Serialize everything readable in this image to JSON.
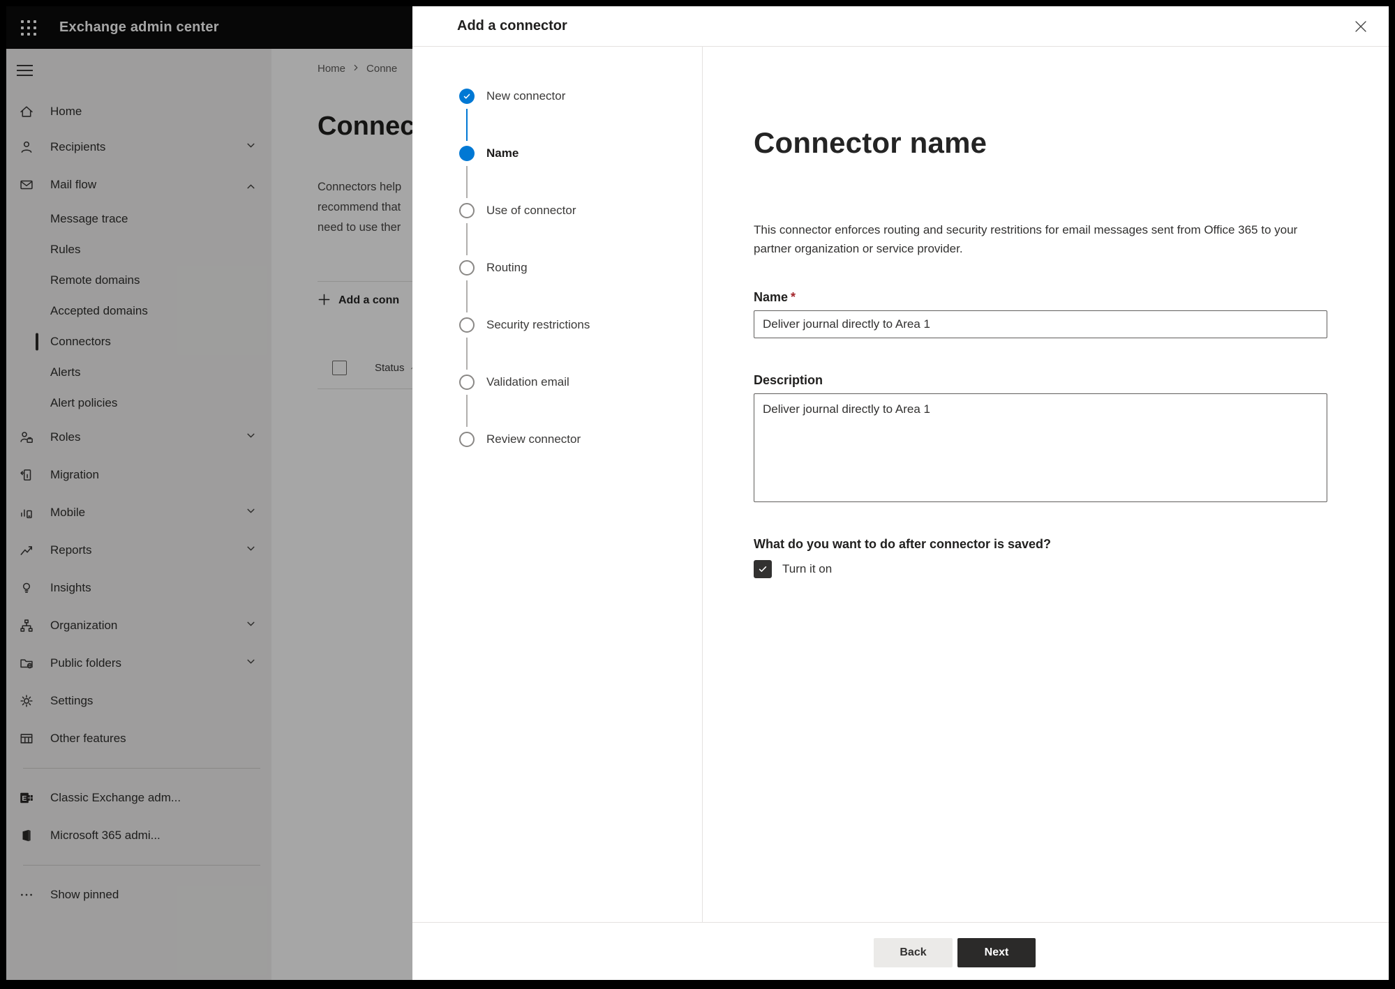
{
  "colors": {
    "accent": "#0078d4",
    "primary_button": "#2b2a29",
    "required_red": "#a4262c",
    "scrim": "rgba(0,0,0,0.35)"
  },
  "topbar": {
    "title": "Exchange admin center"
  },
  "sidebar": {
    "items": [
      {
        "label": "Home",
        "icon": "home"
      },
      {
        "label": "Recipients",
        "icon": "person",
        "chevron": "down"
      },
      {
        "label": "Mail flow",
        "icon": "mail",
        "chevron": "up"
      },
      {
        "label": "Message trace",
        "sub": true
      },
      {
        "label": "Rules",
        "sub": true
      },
      {
        "label": "Remote domains",
        "sub": true
      },
      {
        "label": "Accepted domains",
        "sub": true
      },
      {
        "label": "Connectors",
        "sub": true,
        "selected": true
      },
      {
        "label": "Alerts",
        "sub": true
      },
      {
        "label": "Alert policies",
        "sub": true
      },
      {
        "label": "Roles",
        "icon": "roles",
        "chevron": "down"
      },
      {
        "label": "Migration",
        "icon": "migration"
      },
      {
        "label": "Mobile",
        "icon": "mobile",
        "chevron": "down"
      },
      {
        "label": "Reports",
        "icon": "reports",
        "chevron": "down"
      },
      {
        "label": "Insights",
        "icon": "insights"
      },
      {
        "label": "Organization",
        "icon": "organization",
        "chevron": "down"
      },
      {
        "label": "Public folders",
        "icon": "public-folders",
        "chevron": "down"
      },
      {
        "label": "Settings",
        "icon": "settings"
      },
      {
        "label": "Other features",
        "icon": "other-features"
      },
      {
        "divider": true
      },
      {
        "label": "Classic Exchange adm...",
        "icon": "exchange-logo"
      },
      {
        "label": "Microsoft 365 admi...",
        "icon": "office-logo"
      },
      {
        "divider": true
      },
      {
        "label": "Show pinned",
        "icon": "ellipsis"
      }
    ]
  },
  "background_page": {
    "breadcrumb": [
      "Home",
      "Conne"
    ],
    "title_fragment": "Connec",
    "intro_lines": "Connectors help\nrecommend that\nneed to use ther",
    "add_button_fragment": "Add a conn",
    "list_header": "Status"
  },
  "dialog": {
    "title": "Add a connector",
    "steps": [
      {
        "label": "New connector",
        "state": "complete"
      },
      {
        "label": "Name",
        "state": "current"
      },
      {
        "label": "Use of connector",
        "state": "upcoming"
      },
      {
        "label": "Routing",
        "state": "upcoming"
      },
      {
        "label": "Security restrictions",
        "state": "upcoming"
      },
      {
        "label": "Validation email",
        "state": "upcoming"
      },
      {
        "label": "Review connector",
        "state": "upcoming"
      }
    ],
    "page": {
      "heading": "Connector name",
      "intro": "This connector enforces routing and security restritions for email messages sent from Office 365 to your partner organization or service provider.",
      "name_label": "Name",
      "required_marker": "*",
      "name_value": "Deliver journal directly to Area 1",
      "description_label": "Description",
      "description_value": "Deliver journal directly to Area 1",
      "after_save_question": "What do you want to do after connector is saved?",
      "turn_on_label": "Turn it on",
      "turn_on_checked": true
    },
    "footer": {
      "back_label": "Back",
      "next_label": "Next"
    }
  }
}
